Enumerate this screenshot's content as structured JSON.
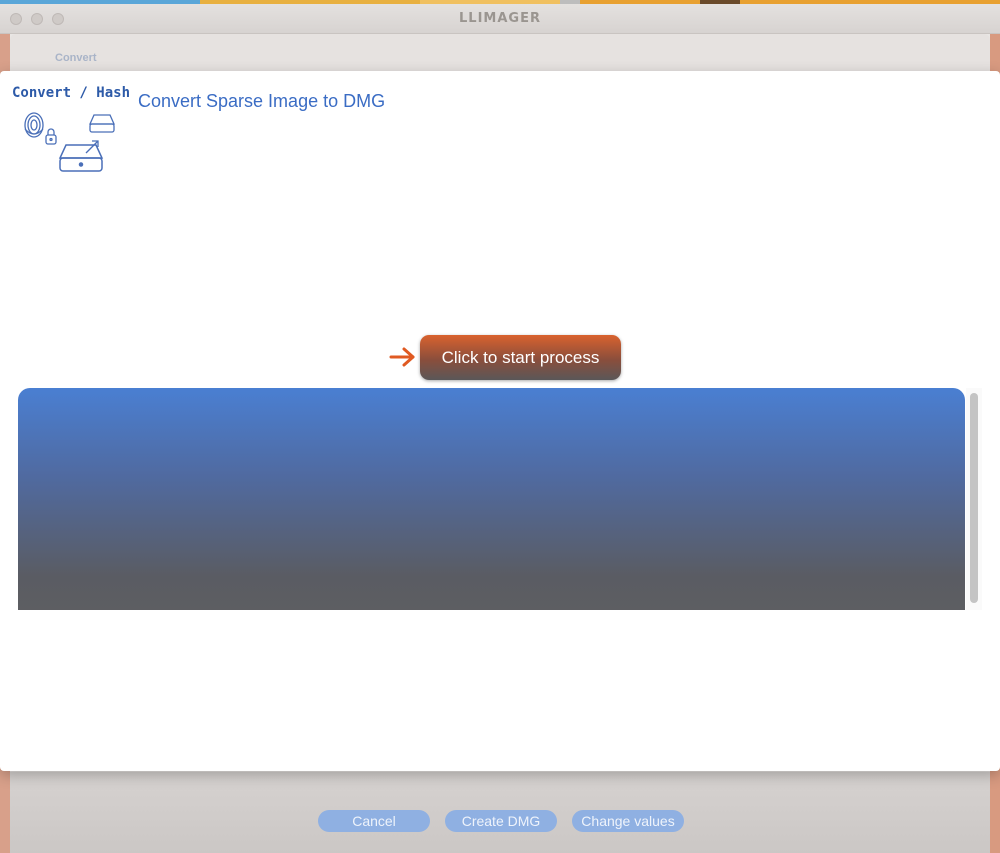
{
  "window": {
    "title": "LLIMAGER",
    "underlying_tab_label": "Convert"
  },
  "underlying_buttons": {
    "cancel": "Cancel",
    "create_dmg": "Create DMG",
    "change_values": "Change values"
  },
  "sheet": {
    "logo_text": "Convert / Hash",
    "title": "Convert Sparse Image to DMG",
    "start_button": "Click to start process",
    "log_output": ""
  },
  "colors": {
    "accent_blue": "#3a6cc4",
    "start_button_orange": "#d9622e",
    "log_gradient_top": "#4a7fd2",
    "log_gradient_bottom": "#5d5e62"
  },
  "icons": [
    "fingerprint-icon",
    "lock-icon",
    "drive-icon",
    "arrow-right-icon"
  ]
}
